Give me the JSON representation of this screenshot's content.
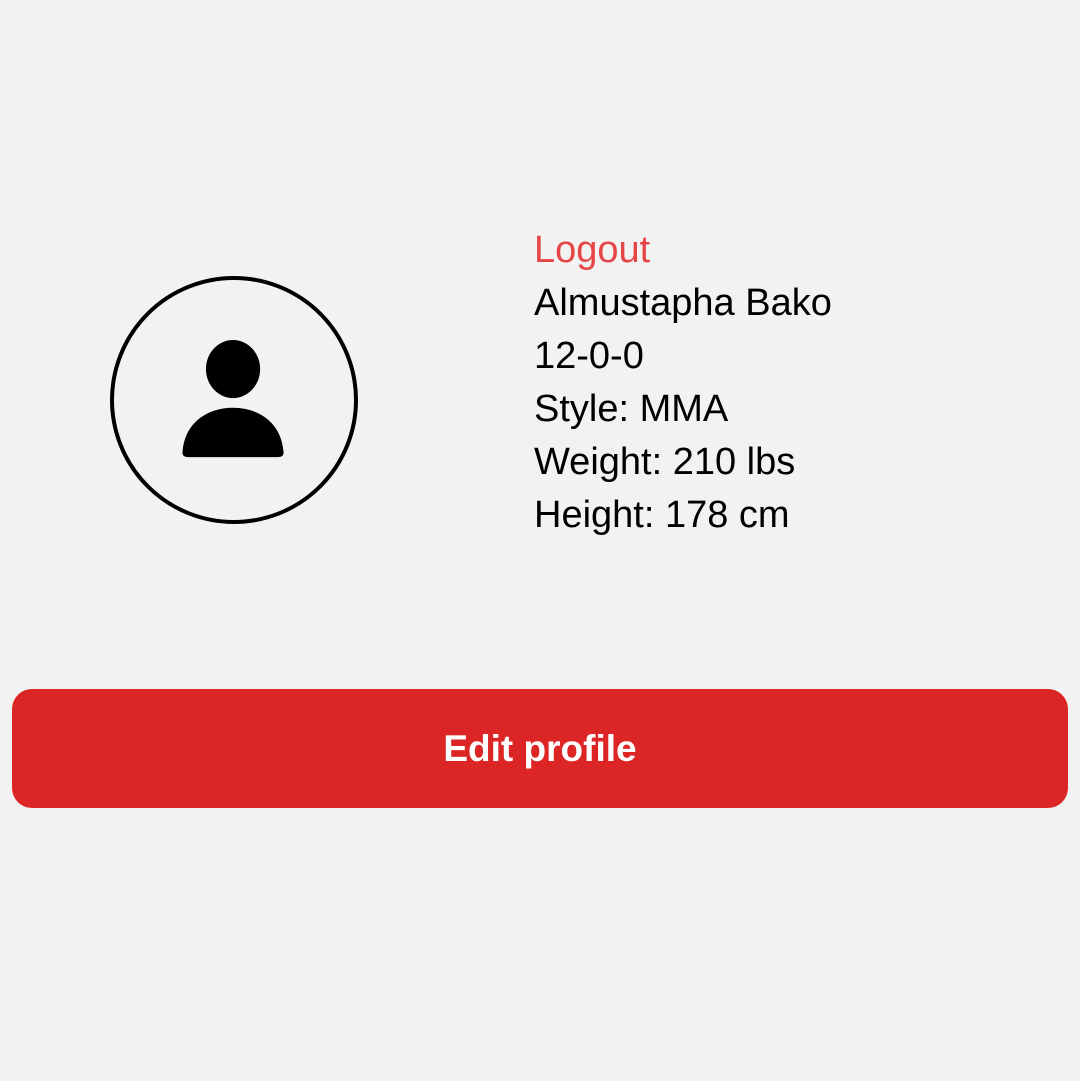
{
  "profile": {
    "avatar_icon": "person-icon",
    "logout_label": "Logout",
    "name": "Almustapha Bako",
    "record": "12-0-0",
    "style": "Style: MMA",
    "weight": "Weight: 210 lbs",
    "height": "Height: 178 cm"
  },
  "actions": {
    "edit_profile_label": "Edit profile"
  },
  "colors": {
    "background": "#f2f2f2",
    "accent": "#dc2626",
    "logout_text": "#e54545"
  }
}
